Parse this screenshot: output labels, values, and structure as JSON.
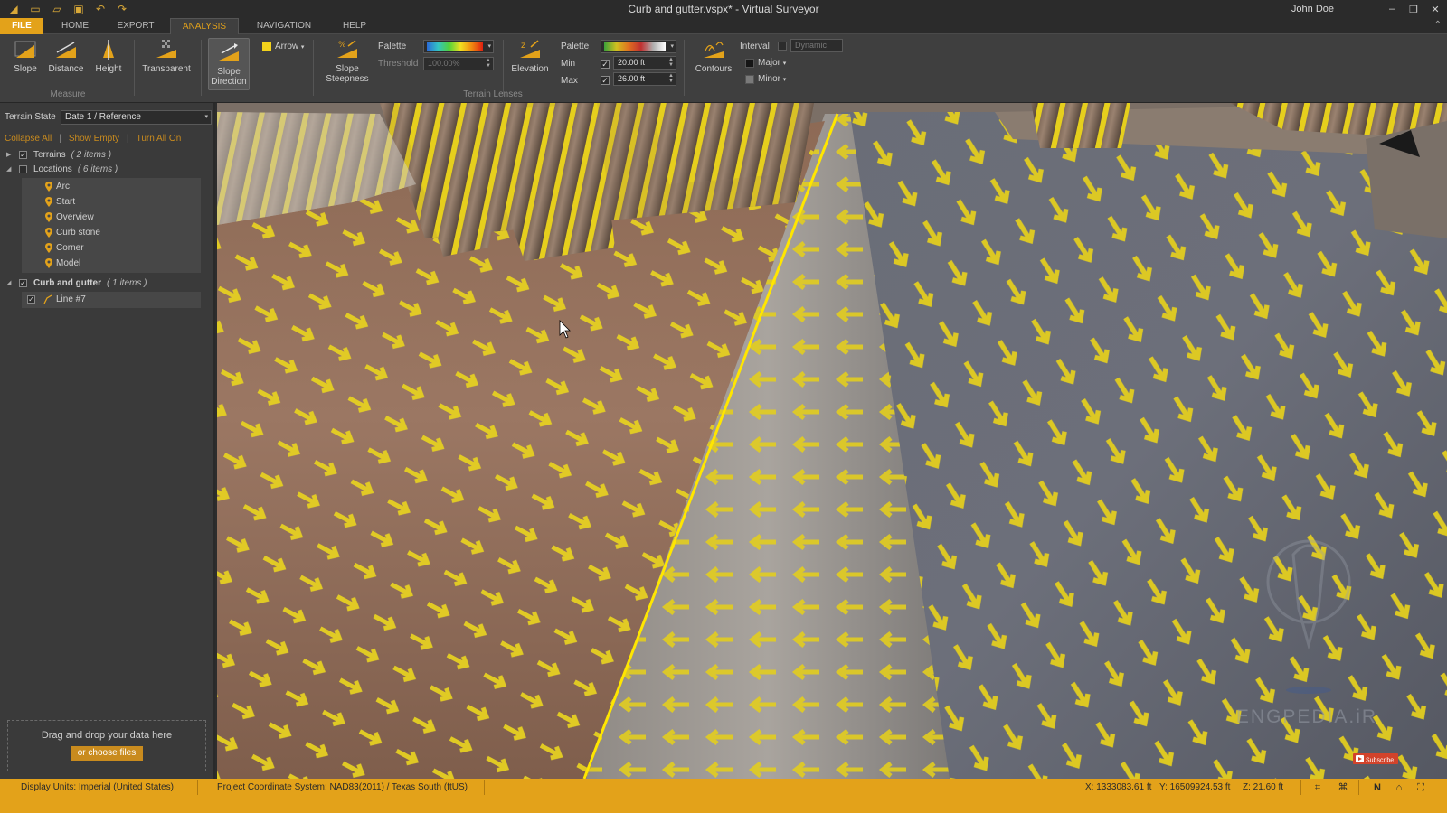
{
  "window": {
    "title": "Curb and gutter.vspx* - Virtual Surveyor",
    "user": "John Doe",
    "quick_access": [
      "app-logo-icon",
      "new-icon",
      "open-icon",
      "save-icon",
      "undo-icon",
      "redo-icon"
    ]
  },
  "menu": {
    "tabs": [
      "FILE",
      "HOME",
      "EXPORT",
      "ANALYSIS",
      "NAVIGATION",
      "HELP"
    ],
    "active": "ANALYSIS"
  },
  "ribbon": {
    "measure": {
      "group_label": "Measure",
      "slope": "Slope",
      "distance": "Distance",
      "height": "Height"
    },
    "transparent": "Transparent",
    "slope_direction": "Slope\nDirection",
    "slope_direction_l1": "Slope",
    "slope_direction_l2": "Direction",
    "arrow_label": "Arrow",
    "arrow_color": "#f2d21b",
    "slope_steepness_l1": "Slope",
    "slope_steepness_l2": "Steepness",
    "steepness_palette_label": "Palette",
    "threshold_label": "Threshold",
    "threshold_value": "100.00%",
    "terrain_lenses_label": "Terrain Lenses",
    "elevation": "Elevation",
    "elev_palette_label": "Palette",
    "min_label": "Min",
    "min_value": "20.00 ft",
    "max_label": "Max",
    "max_value": "26.00 ft",
    "contours": "Contours",
    "interval_label": "Interval",
    "interval_placeholder": "Dynamic",
    "major_label": "Major",
    "minor_label": "Minor"
  },
  "left_panel": {
    "terrain_state_label": "Terrain State",
    "terrain_state_value": "Date 1 / Reference",
    "collapse_all": "Collapse All",
    "show_empty": "Show Empty",
    "turn_all_on": "Turn All On",
    "terrains": {
      "label": "Terrains",
      "count": "( 2 items )"
    },
    "locations": {
      "label": "Locations",
      "count": "( 6 items )",
      "items": [
        "Arc",
        "Start",
        "Overview",
        "Curb stone",
        "Corner",
        "Model"
      ]
    },
    "curb_gutter": {
      "label": "Curb and gutter",
      "count": "( 1 items )",
      "items": [
        "Line #7"
      ]
    },
    "dropzone_text": "Drag and drop your data here",
    "dropzone_button": "or choose files"
  },
  "viewport": {
    "watermark": "ENGPEDIA.iR",
    "subscribe": "Subscribe"
  },
  "status": {
    "display_units": "Display Units: Imperial (United States)",
    "coordinate_system": "Project Coordinate System: NAD83(2011) / Texas South (ftUS)",
    "x": "X: 1333083.61 ft",
    "y": "Y: 16509924.53 ft",
    "z": "Z: 21.60 ft"
  },
  "colors": {
    "accent": "#e3a21a",
    "arrow": "#f2d21b",
    "line": "#ffe600"
  }
}
